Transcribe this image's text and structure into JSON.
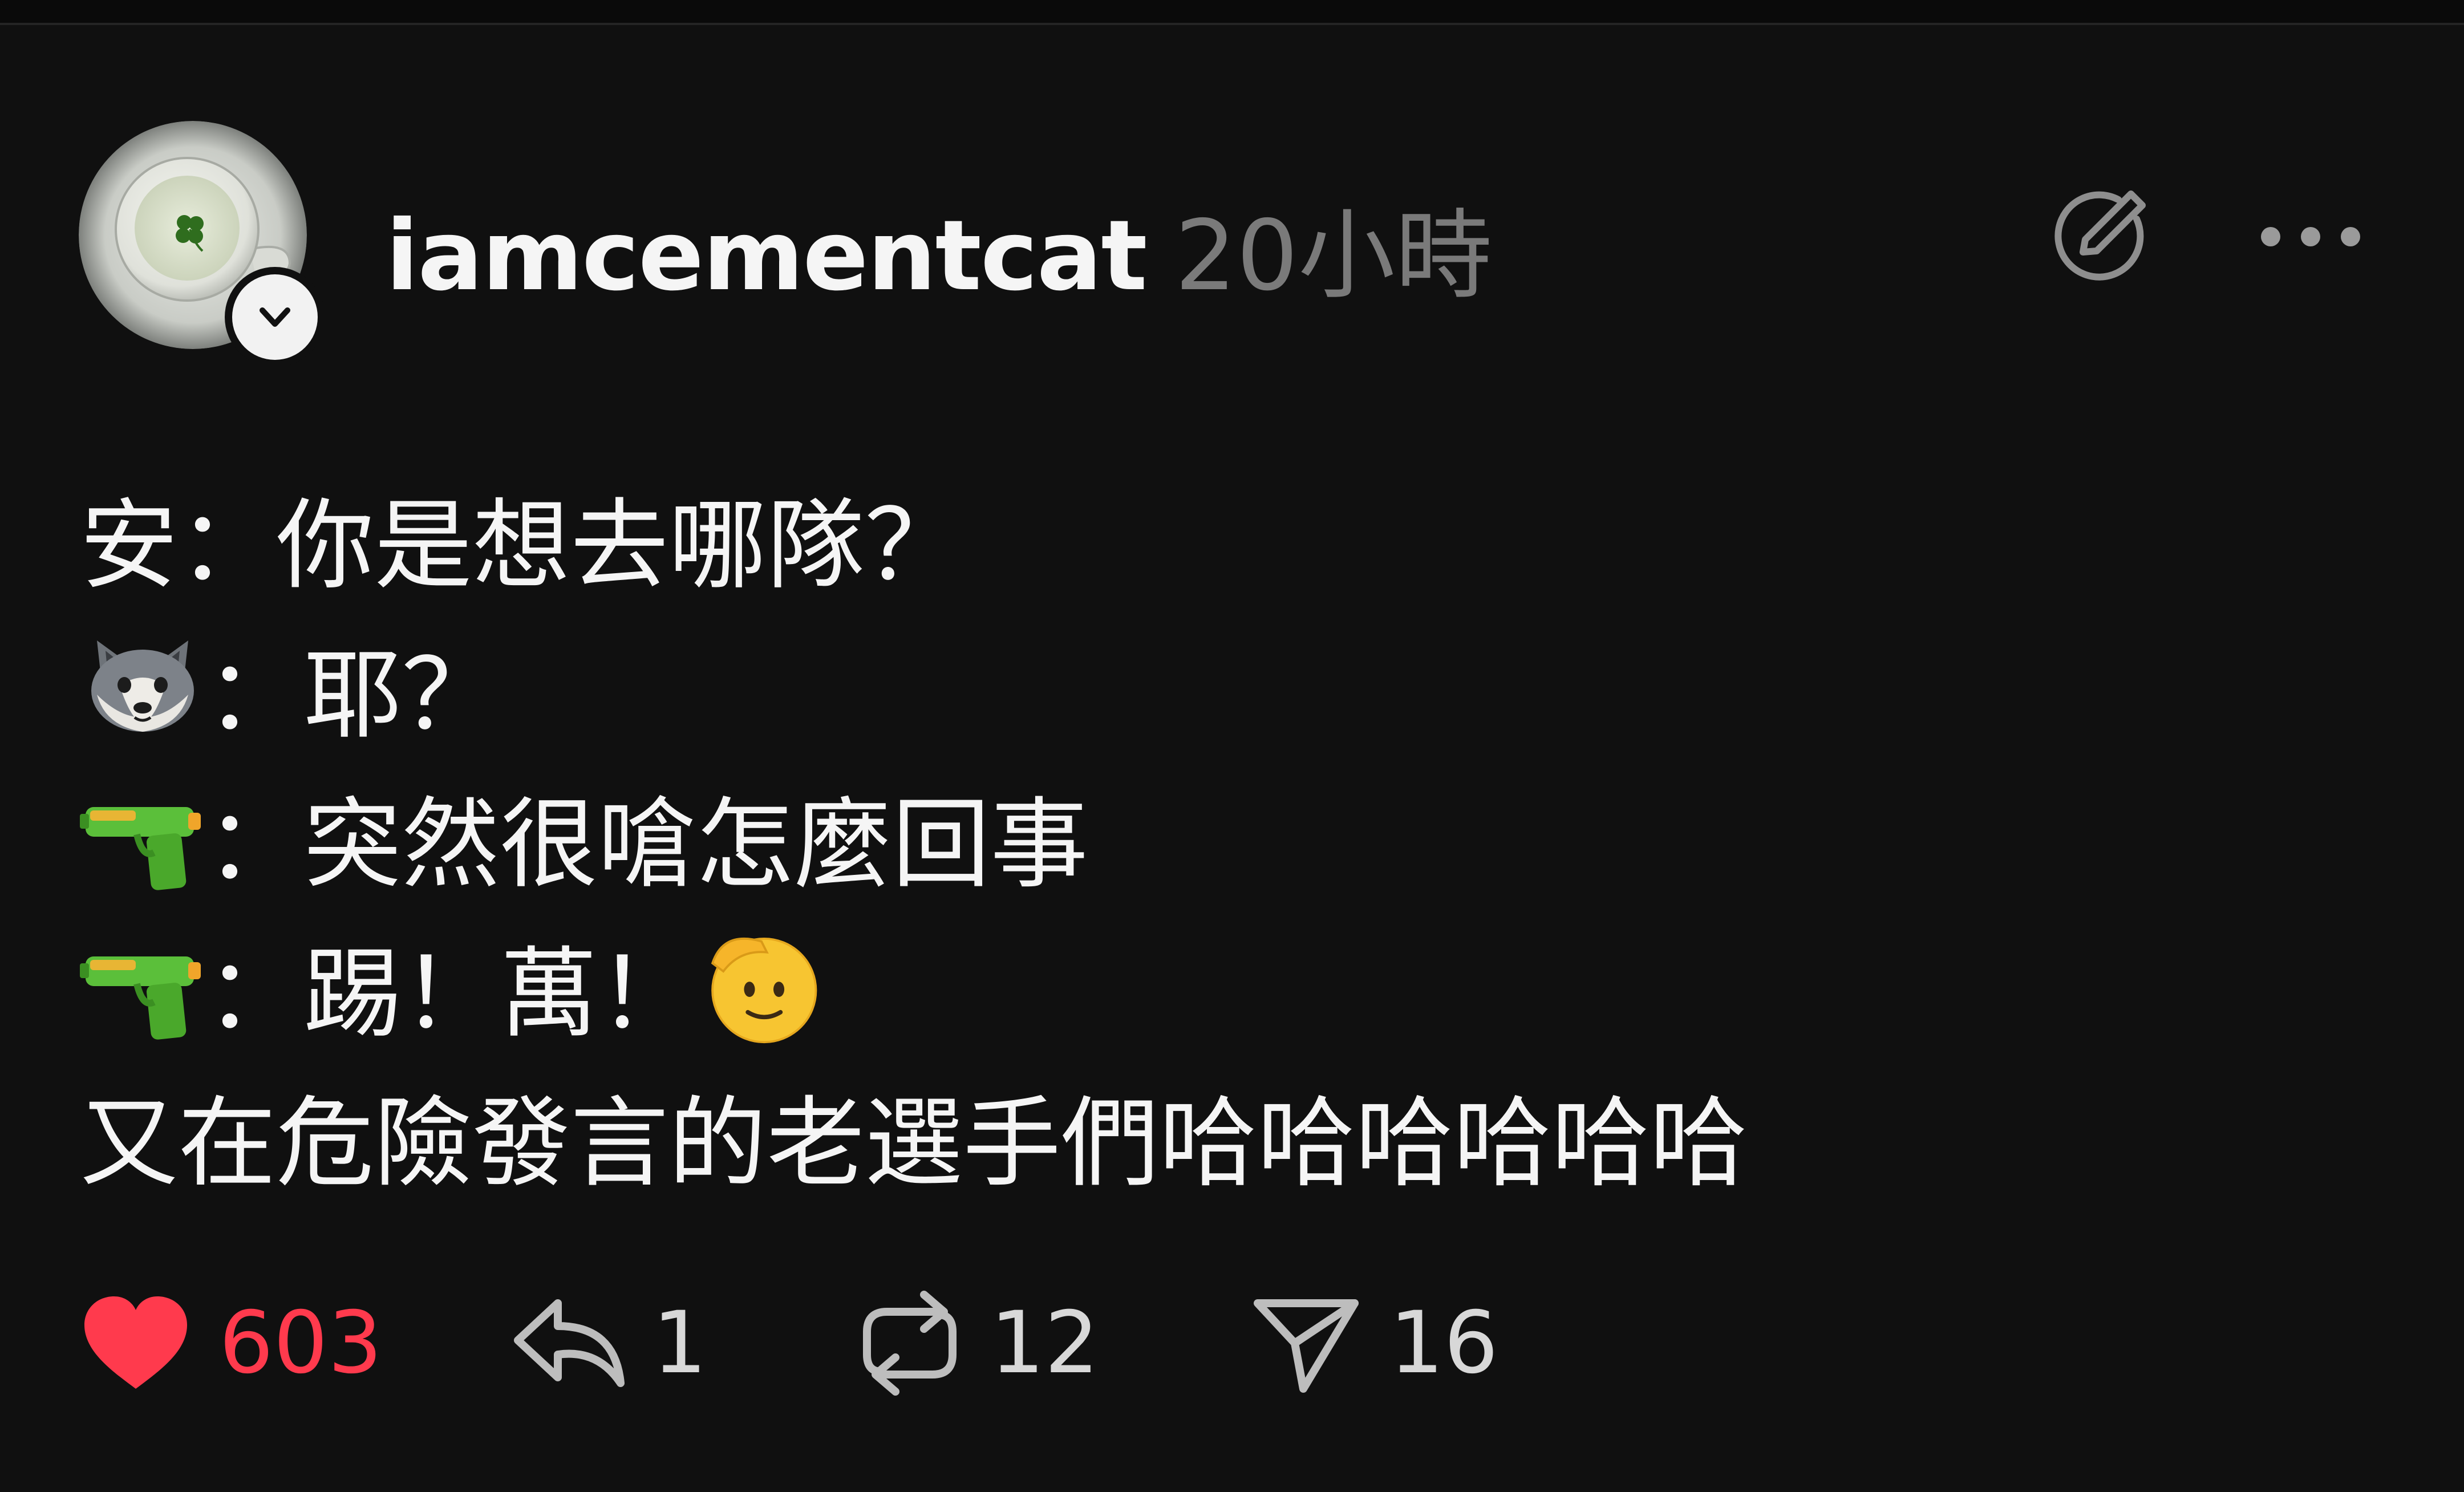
{
  "post": {
    "username": "iamcementcat",
    "timestamp": "20小時",
    "lines": [
      {
        "prefix_icon": "",
        "text": "安：你是想去哪隊？"
      },
      {
        "prefix_icon": "wolf-face-emoji",
        "text": "：耶？"
      },
      {
        "prefix_icon": "water-pistol-emoji",
        "text": "：突然很嗆怎麼回事"
      },
      {
        "prefix_icon": "water-pistol-emoji",
        "text": "：踢！萬！",
        "suffix_icon": "saluting-face-emoji"
      },
      {
        "prefix_icon": "",
        "text": "又在危險發言的老選手們哈哈哈哈哈哈"
      }
    ]
  },
  "actions": {
    "likes": "603",
    "replies": "1",
    "reposts": "12",
    "shares": "16"
  },
  "colors": {
    "background": "#101010",
    "like_red": "#ff3a4d",
    "muted": "#7a7a7a"
  }
}
